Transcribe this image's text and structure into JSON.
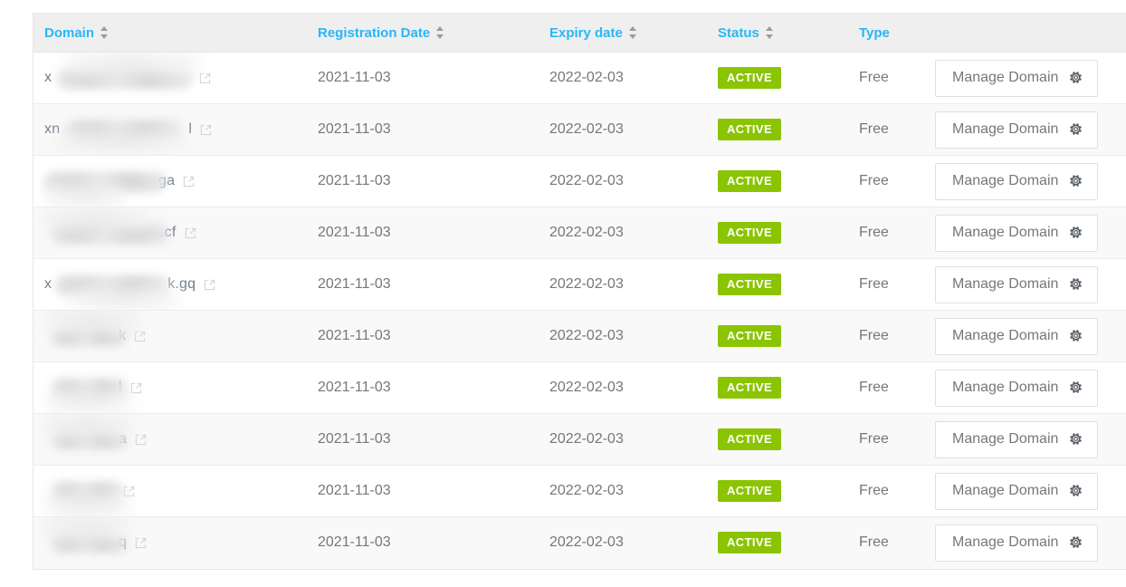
{
  "colors": {
    "header_text": "#29b6f6",
    "badge_active_bg": "#8bc400",
    "body_text": "#777777",
    "row_alt_bg": "#f9f9f9",
    "border": "#ececec"
  },
  "table": {
    "columns": [
      {
        "key": "domain",
        "label": "Domain",
        "sortable": true
      },
      {
        "key": "registration",
        "label": "Registration Date",
        "sortable": true
      },
      {
        "key": "expiry",
        "label": "Expiry date",
        "sortable": true
      },
      {
        "key": "status",
        "label": "Status",
        "sortable": true
      },
      {
        "key": "type",
        "label": "Type",
        "sortable": false
      },
      {
        "key": "action",
        "label": "",
        "sortable": false
      }
    ],
    "action_label": "Manage Domain",
    "icons": {
      "sort": "sort-icon",
      "external_link": "external-link-icon",
      "gear": "gear-icon"
    },
    "rows": [
      {
        "domain_prefix": "x",
        "domain_suffix": "",
        "registration": "2021-11-03",
        "expiry": "2022-02-03",
        "status": "ACTIVE",
        "type": "Free",
        "action": "Manage Domain"
      },
      {
        "domain_prefix": "xn",
        "domain_suffix": "l",
        "registration": "2021-11-03",
        "expiry": "2022-02-03",
        "status": "ACTIVE",
        "type": "Free",
        "action": "Manage Domain"
      },
      {
        "domain_prefix": "",
        "domain_suffix": "ga",
        "registration": "2021-11-03",
        "expiry": "2022-02-03",
        "status": "ACTIVE",
        "type": "Free",
        "action": "Manage Domain"
      },
      {
        "domain_prefix": "",
        "domain_suffix": ".cf",
        "registration": "2021-11-03",
        "expiry": "2022-02-03",
        "status": "ACTIVE",
        "type": "Free",
        "action": "Manage Domain"
      },
      {
        "domain_prefix": "x",
        "domain_suffix": "k.gq",
        "registration": "2021-11-03",
        "expiry": "2022-02-03",
        "status": "ACTIVE",
        "type": "Free",
        "action": "Manage Domain"
      },
      {
        "domain_prefix": "",
        "domain_suffix": "k",
        "registration": "2021-11-03",
        "expiry": "2022-02-03",
        "status": "ACTIVE",
        "type": "Free",
        "action": "Manage Domain"
      },
      {
        "domain_prefix": "",
        "domain_suffix": "l",
        "registration": "2021-11-03",
        "expiry": "2022-02-03",
        "status": "ACTIVE",
        "type": "Free",
        "action": "Manage Domain"
      },
      {
        "domain_prefix": "",
        "domain_suffix": "a",
        "registration": "2021-11-03",
        "expiry": "2022-02-03",
        "status": "ACTIVE",
        "type": "Free",
        "action": "Manage Domain"
      },
      {
        "domain_prefix": "",
        "domain_suffix": "",
        "registration": "2021-11-03",
        "expiry": "2022-02-03",
        "status": "ACTIVE",
        "type": "Free",
        "action": "Manage Domain"
      },
      {
        "domain_prefix": "",
        "domain_suffix": "q",
        "registration": "2021-11-03",
        "expiry": "2022-02-03",
        "status": "ACTIVE",
        "type": "Free",
        "action": "Manage Domain"
      }
    ]
  }
}
